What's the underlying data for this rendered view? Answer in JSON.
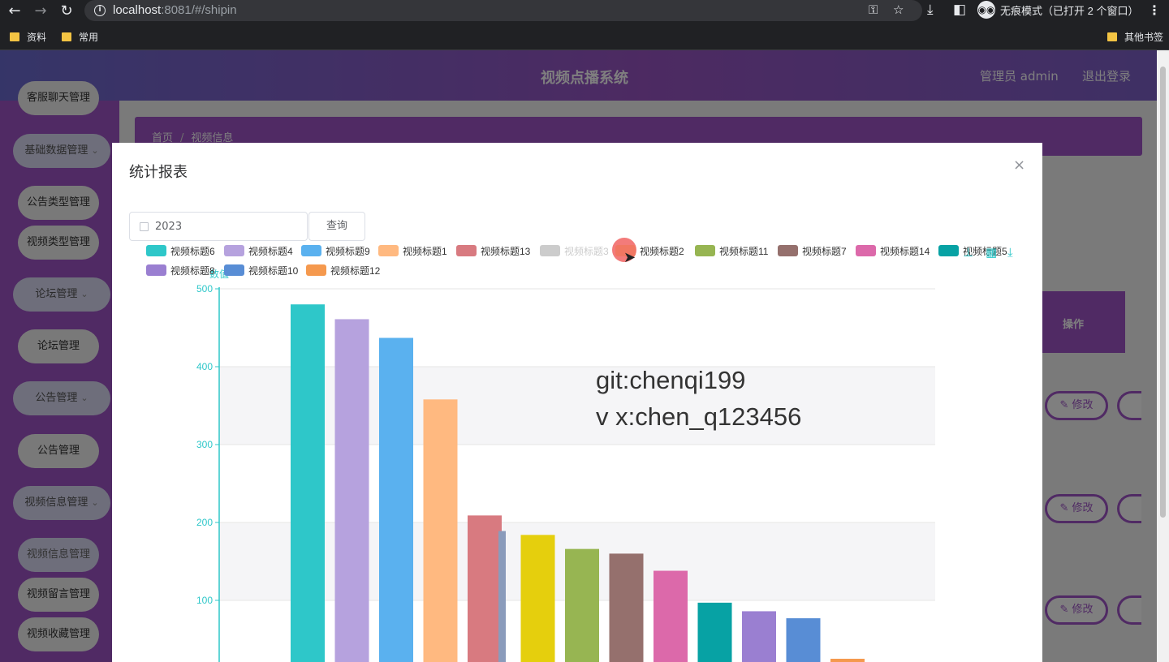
{
  "browser": {
    "url_host": "localhost",
    "url_rest": ":8081/#/shipin",
    "incognito_label": "无痕模式（已打开 2 个窗口）",
    "bookmarks": [
      "资料",
      "常用"
    ],
    "other_bookmarks": "其他书签"
  },
  "app": {
    "title": "视频点播系统",
    "admin": "管理员 admin",
    "logout": "退出登录",
    "breadcrumb": [
      "首页",
      "视频信息"
    ],
    "table_op_header": "操作",
    "edit_label": "修改",
    "sidebar": [
      {
        "label": "客服聊天管理",
        "type": "pill"
      },
      {
        "label": "基础数据管理",
        "type": "group"
      },
      {
        "label": "公告类型管理",
        "type": "pill"
      },
      {
        "label": "视频类型管理",
        "type": "pill"
      },
      {
        "label": "论坛管理",
        "type": "group"
      },
      {
        "label": "论坛管理",
        "type": "pill"
      },
      {
        "label": "公告管理",
        "type": "group"
      },
      {
        "label": "公告管理",
        "type": "pill"
      },
      {
        "label": "视频信息管理",
        "type": "group"
      },
      {
        "label": "视频信息管理",
        "type": "pill-active"
      },
      {
        "label": "视频留言管理",
        "type": "pill"
      },
      {
        "label": "视频收藏管理",
        "type": "pill"
      }
    ]
  },
  "modal": {
    "title": "统计报表",
    "close": "×",
    "date_value": "2023",
    "query_button": "查询",
    "watermark_line1": "git:chenqi199",
    "watermark_line2": "v x:chen_q123456"
  },
  "chart_data": {
    "type": "bar",
    "ylabel": "数值",
    "ylim": [
      0,
      500
    ],
    "yticks": [
      100,
      200,
      300,
      400,
      500
    ],
    "legend": [
      {
        "name": "视频标题6",
        "color": "#2ec7c9",
        "on": true
      },
      {
        "name": "视频标题4",
        "color": "#b6a2de",
        "on": true
      },
      {
        "name": "视频标题9",
        "color": "#5ab1ef",
        "on": true
      },
      {
        "name": "视频标题1",
        "color": "#ffb980",
        "on": true
      },
      {
        "name": "视频标题13",
        "color": "#d87a80",
        "on": true
      },
      {
        "name": "视频标题3",
        "color": "#cccccc",
        "on": false
      },
      {
        "name": "视频标题2",
        "color": "#e5cf0d",
        "on": true
      },
      {
        "name": "视频标题11",
        "color": "#97b552",
        "on": true
      },
      {
        "name": "视频标题7",
        "color": "#95706d",
        "on": true
      },
      {
        "name": "视频标题14",
        "color": "#dc69aa",
        "on": true
      },
      {
        "name": "视频标题5",
        "color": "#07a2a4",
        "on": true
      },
      {
        "name": "视频标题8",
        "color": "#9a7fd1",
        "on": true
      },
      {
        "name": "视频标题10",
        "color": "#588dd5",
        "on": true
      },
      {
        "name": "视频标题12",
        "color": "#f5994e",
        "on": true
      }
    ],
    "series": [
      {
        "name": "视频标题6",
        "value": 480,
        "color": "#2ec7c9"
      },
      {
        "name": "视频标题4",
        "value": 461,
        "color": "#b6a2de"
      },
      {
        "name": "视频标题9",
        "value": 437,
        "color": "#5ab1ef"
      },
      {
        "name": "视频标题1",
        "value": 358,
        "color": "#ffb980"
      },
      {
        "name": "视频标题13",
        "value": 209,
        "color": "#d87a80"
      },
      {
        "name": "视频标题2",
        "value": 184,
        "color": "#e5cf0d"
      },
      {
        "name": "视频标题11",
        "value": 166,
        "color": "#97b552"
      },
      {
        "name": "视频标题7",
        "value": 160,
        "color": "#95706d"
      },
      {
        "name": "视频标题14",
        "value": 138,
        "color": "#dc69aa"
      },
      {
        "name": "视频标题5",
        "value": 97,
        "color": "#07a2a4"
      },
      {
        "name": "视频标题8",
        "value": 86,
        "color": "#9a7fd1"
      },
      {
        "name": "视频标题10",
        "value": 77,
        "color": "#588dd5"
      },
      {
        "name": "视频标题12",
        "value": 25,
        "color": "#f5994e"
      }
    ],
    "fading_bar_value": 189
  }
}
